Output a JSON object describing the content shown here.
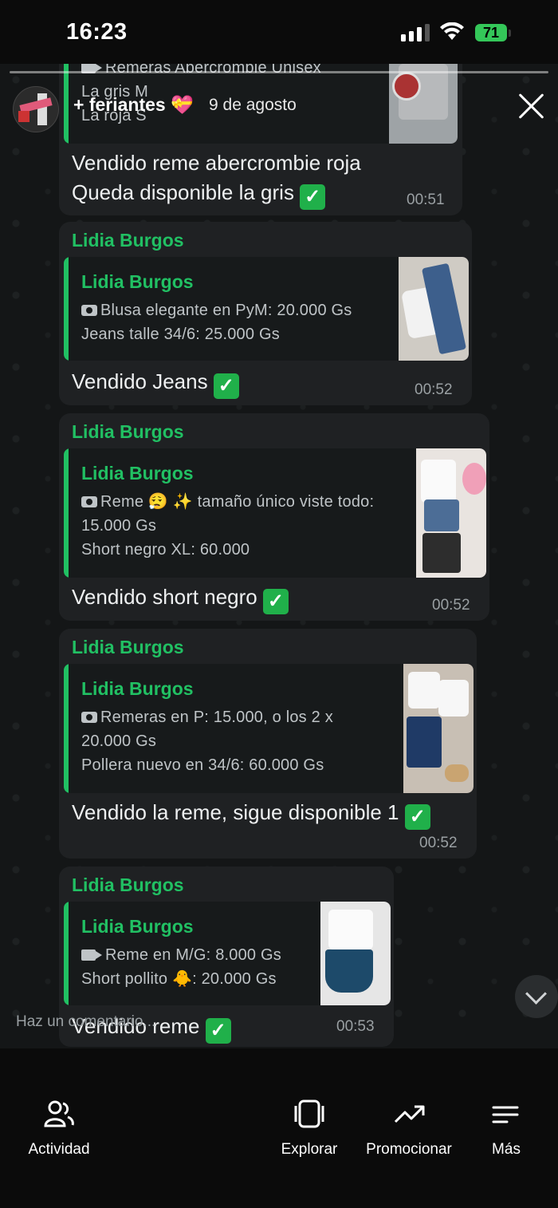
{
  "status_bar": {
    "time": "16:23",
    "battery": "71"
  },
  "story": {
    "group_name": "+ feriantes 💝",
    "date": "9 de agosto",
    "comment_placeholder": "Haz un comentario..."
  },
  "messages": [
    {
      "quote_title": "Remeras Abercrombie Unisex",
      "quote_lines": [
        "La gris M",
        "La roja S"
      ],
      "text_lines": [
        "Vendido reme abercrombie roja",
        "Queda disponible la gris"
      ],
      "time": "00:51"
    },
    {
      "sender": "Lidia Burgos",
      "quote_name": "Lidia Burgos",
      "quote_lines": [
        "Blusa elegante en PyM: 20.000 Gs",
        "Jeans talle 34/6: 25.000 Gs"
      ],
      "text": "Vendido Jeans",
      "time": "00:52"
    },
    {
      "sender": "Lidia Burgos",
      "quote_name": "Lidia Burgos",
      "quote_lines": [
        "Reme 😮‍💨 ✨  tamaño único viste todo:",
        "15.000 Gs",
        "Short negro XL: 60.000"
      ],
      "text": "Vendido short negro",
      "time": "00:52"
    },
    {
      "sender": "Lidia Burgos",
      "quote_name": "Lidia Burgos",
      "quote_lines": [
        "Remeras en P: 15.000, o los 2 x",
        "20.000 Gs",
        "Pollera nuevo en 34/6: 60.000 Gs"
      ],
      "text": "Vendido la reme, sigue disponible 1",
      "time": "00:52"
    },
    {
      "sender": "Lidia Burgos",
      "quote_name": "Lidia Burgos",
      "quote_lines": [
        "Reme en M/G: 8.000 Gs",
        "Short pollito 🐥: 20.000 Gs"
      ],
      "text": "Vendido reme",
      "time": "00:53"
    }
  ],
  "bottom_nav": [
    {
      "label": "Actividad",
      "icon": "people-icon"
    },
    {
      "label": "Explorar",
      "icon": "cards-icon"
    },
    {
      "label": "Promocionar",
      "icon": "trend-up-icon"
    },
    {
      "label": "Más",
      "icon": "menu-lines-icon"
    }
  ],
  "colors": {
    "sender_green": "#21c063",
    "check_green": "#20b04a",
    "bubble": "#1f2123",
    "battery": "#34c759"
  }
}
